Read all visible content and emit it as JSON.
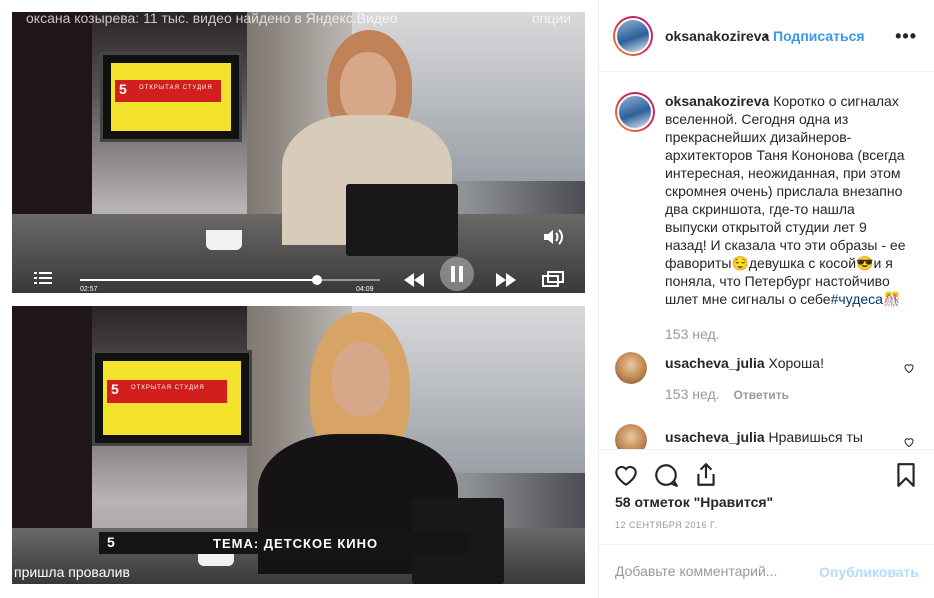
{
  "media": {
    "top_overlay_title": "оксана козырева: 11 тыс. видео найдено в Яндекс.Видео",
    "top_overlay_options": "опции",
    "video_time_current": "02:57",
    "video_time_total": "04:09",
    "video_progress_fraction": 0.79,
    "monitor_logo_number": "5",
    "monitor_logo_text": "ОТКРЫТАЯ СТУДИЯ",
    "ticker_number": "5",
    "ticker_label": "ТЕМА: ДЕТСКОЕ КИНО",
    "bottom_caption": "пришла провалив"
  },
  "post": {
    "author": "oksanakozireva",
    "separator": "•",
    "follow_label": "Подписаться",
    "more_label": "•••",
    "caption": "Коротко о сигналах вселенной. Сегодня одна из прекраснейших дизайнеров-архитекторов Таня Кононова (всегда интересная, неожиданная, при этом скромнея очень) прислала внезапно два скриншота, где-то нашла выпуски открытой студии лет 9 назад! И сказала что эти образы - ее фавориты",
    "caption_part2": "девушка с косой",
    "caption_part3": "и я поняла, что Петербург настойчиво шлет мне сигналы о себе",
    "caption_hashtag": "#чудеса",
    "emoji_1": "😌",
    "emoji_2": "😎",
    "emoji_3": "🎊",
    "caption_time": "153 нед.",
    "comments": [
      {
        "user": "usacheva_julia",
        "text": "Хороша!",
        "time": "153 нед.",
        "reply_label": "Ответить"
      },
      {
        "user": "usacheva_julia",
        "text": "Нравишься ты"
      }
    ],
    "likes_text": "58 отметок \"Нравится\"",
    "date_text": "12 СЕНТЯБРЯ 2016 Г.",
    "comment_placeholder": "Добавьте комментарий...",
    "publish_label": "Опубликовать"
  }
}
